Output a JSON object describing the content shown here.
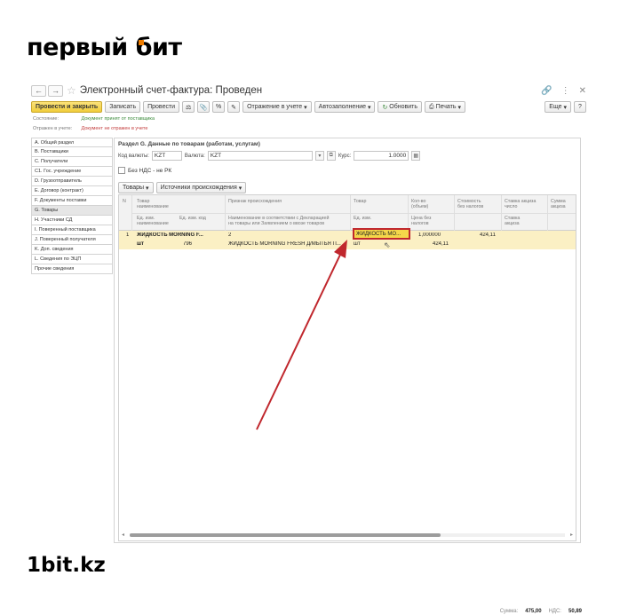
{
  "branding": {
    "top_logo": "первый бит",
    "footer": "1bit.kz"
  },
  "window": {
    "title": "Электронный счет-фактура: Проведен",
    "nav_back": "←",
    "nav_forward": "→",
    "menu_icons": [
      "link-icon",
      "more-icon",
      "close-icon"
    ]
  },
  "toolbar": {
    "post_close": "Провести и закрыть",
    "save": "Записать",
    "post": "Провести",
    "reflection": "Отражение в учете",
    "autofill": "Автозаполнение",
    "refresh": "Обновить",
    "print": "Печать",
    "more": "Еще",
    "help": "?"
  },
  "status": {
    "state_label": "Состояние:",
    "state_value": "Документ принят от поставщика",
    "reflect_label": "Отражен в учете:",
    "reflect_value": "Документ не отражен в учете"
  },
  "sidebar": {
    "items": [
      "A. Общий раздел",
      "B. Поставщики",
      "C. Получатели",
      "C1. Гос. учреждение",
      "D. Грузоотправитель",
      "E. Договор (контракт)",
      "F. Документы поставки",
      "G. Товары",
      "H. Участники СД",
      "I. Поверенный поставщика",
      "J. Поверенный получателя",
      "K. Доп. сведения",
      "L. Сведения по ЭЦП",
      "Прочие сведения"
    ],
    "active_index": 7
  },
  "section": {
    "title": "Раздел G. Данные по товарам (работам, услугам)",
    "currency_code_label": "Код валюты:",
    "currency_code": "KZT",
    "currency_label": "Валюта:",
    "currency": "KZT",
    "rate_label": "Курс:",
    "rate": "1.0000",
    "no_vat_label": "Без НДС - не РК",
    "tab_goods": "Товары",
    "tab_origin": "Источники происхождения"
  },
  "grid": {
    "headers": {
      "n": "N",
      "goods_1": "Товар",
      "goods_2": "наименование",
      "unit": "Ед. изм.",
      "unit_2": "наименование",
      "unit_code": "Ед. изм. код",
      "origin_1": "Признак происхождения",
      "origin_2": "Наименование в соответствии с Декларацией",
      "origin_3": "на товары или Заявлением о ввозе товаров",
      "product": "Товар",
      "product_unit": "Ед. изм.",
      "qty_1": "Кол-во",
      "qty_2": "(объем)",
      "price_1": "Цена без",
      "price_2": "налогов",
      "cost_1": "Стоимость",
      "cost_2": "без налогов",
      "excise_1": "Ставка акциза",
      "excise_2": "число",
      "excise_3": "Ставка",
      "excise_4": "акциза",
      "excise_sum_1": "Сумма",
      "excise_sum_2": "акциза"
    },
    "row": {
      "n": "1",
      "name": "ЖИДКОСТЬ MORNING F...",
      "unit_name": "шт",
      "unit_code": "796",
      "origin": "2",
      "decl_name": "ЖИДКОСТЬ MORNING FRESH Д/МЫТЬЯ П...",
      "product": "ЖИДКОСТЬ МО...",
      "product_unit": "шт",
      "qty": "1,000000",
      "price": "424,11",
      "cost": "424,11"
    }
  },
  "totals": {
    "sum_label": "Сумма:",
    "sum": "475,00",
    "vat_label": "НДС:",
    "vat": "50,89"
  },
  "colors": {
    "primary_button": "#f1cd3b",
    "selected_row": "#fbf0c4",
    "highlight_border": "#c0272d",
    "arrow": "#c0272d",
    "brand_accent": "#f07d00"
  }
}
